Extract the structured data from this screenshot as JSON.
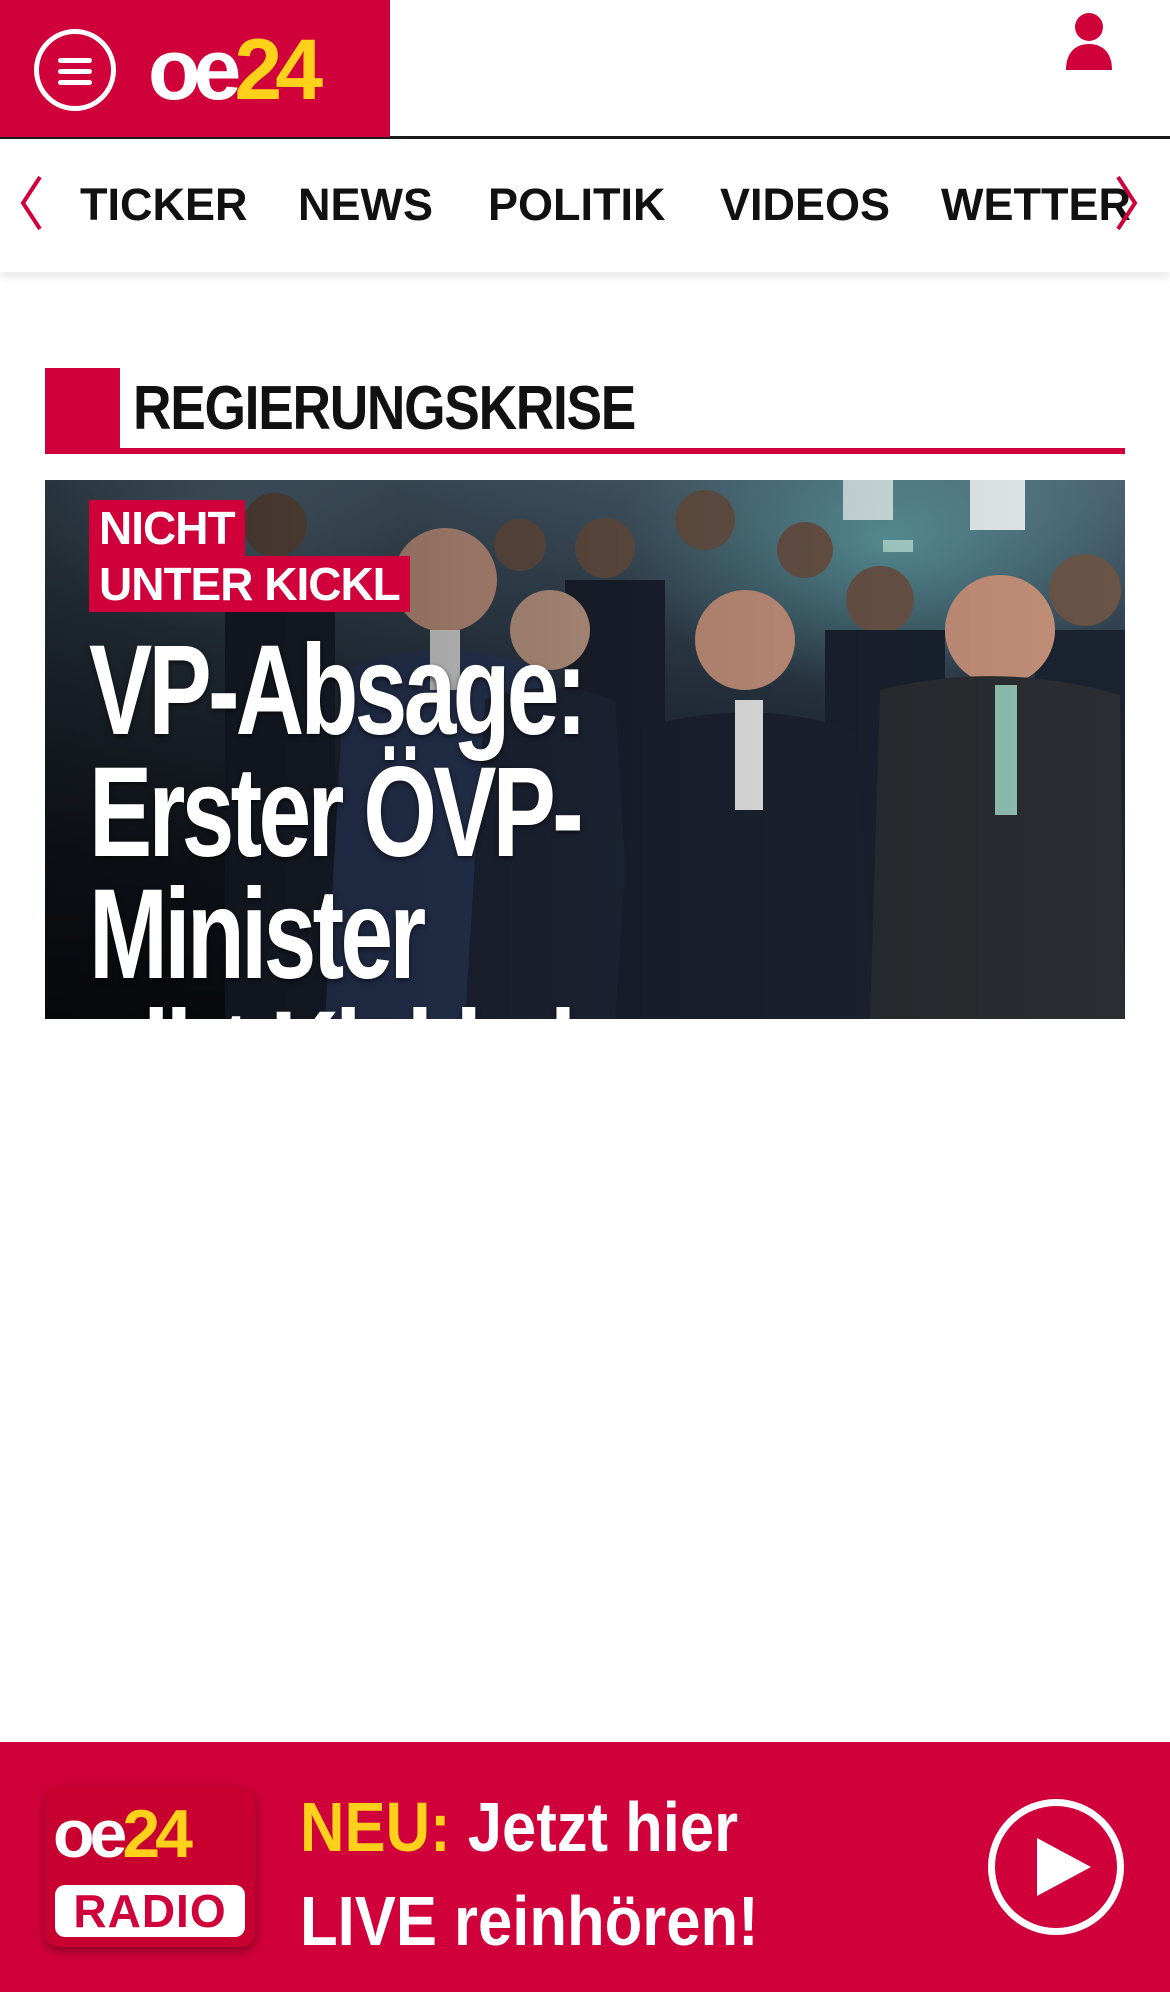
{
  "header": {
    "logo_oe": "oe",
    "logo_24": "24",
    "brand_color": "#d0003a",
    "accent_color": "#ffd11a",
    "menu_icon": "hamburger-menu-icon",
    "user_icon": "user-icon"
  },
  "nav": {
    "items": [
      {
        "label": "TICKER"
      },
      {
        "label": "NEWS"
      },
      {
        "label": "POLITIK"
      },
      {
        "label": "VIDEOS"
      },
      {
        "label": "WETTER"
      }
    ],
    "prev_icon": "chevron-left-icon",
    "next_icon": "chevron-right-icon"
  },
  "section": {
    "title": "REGIERUNGSKRISE"
  },
  "hero": {
    "kicker_line1": "NICHT",
    "kicker_line2": "UNTER KICKL",
    "headline_line1": "VP-Absage:",
    "headline_line2": "Erster ÖVP-Minister",
    "headline_line3": "gibt Kickl einen Korb"
  },
  "radio": {
    "logo_oe": "oe",
    "logo_24": "24",
    "logo_radio": "RADIO",
    "neu_label": "NEU:",
    "line1_rest": "Jetzt hier",
    "line2": "LIVE reinhören!",
    "play_icon": "play-icon"
  }
}
